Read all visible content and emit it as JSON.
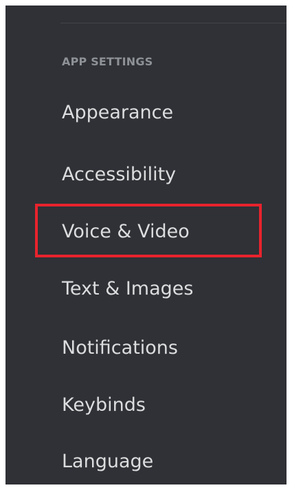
{
  "sidebar": {
    "section_header": "APP SETTINGS",
    "items": [
      {
        "label": "Appearance"
      },
      {
        "label": "Accessibility"
      },
      {
        "label": "Voice & Video"
      },
      {
        "label": "Text & Images"
      },
      {
        "label": "Notifications"
      },
      {
        "label": "Keybinds"
      },
      {
        "label": "Language"
      }
    ]
  },
  "colors": {
    "background": "#2f3136",
    "header_text": "#8e9297",
    "item_text": "#dcddde",
    "highlight": "#e8232d"
  }
}
